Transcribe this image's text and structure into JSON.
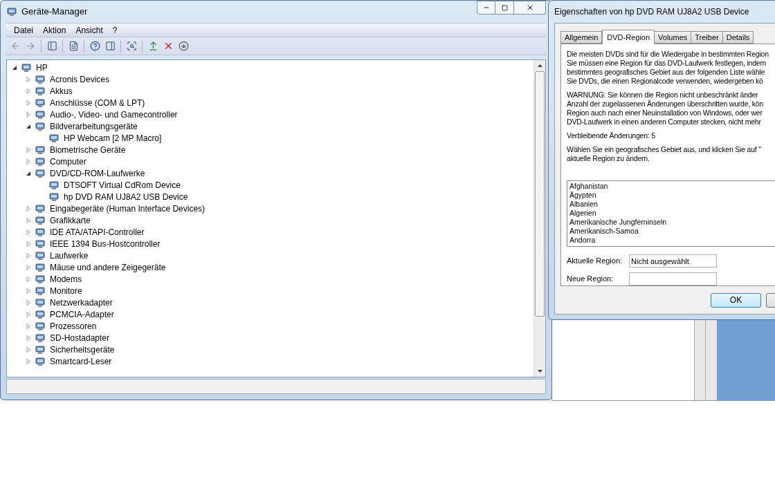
{
  "device_manager": {
    "title": "Geräte-Manager",
    "menu": [
      "Datei",
      "Aktion",
      "Ansicht",
      "?"
    ],
    "tree": [
      {
        "label": "HP",
        "expanded": true,
        "children": [
          {
            "label": "Acronis Devices",
            "expanded": false
          },
          {
            "label": "Akkus",
            "expanded": false
          },
          {
            "label": "Anschlüsse (COM & LPT)",
            "expanded": false
          },
          {
            "label": "Audio-, Video- und Gamecontroller",
            "expanded": false
          },
          {
            "label": "Bildverarbeitungsgeräte",
            "expanded": true,
            "children": [
              {
                "label": "HP Webcam [2 MP Macro]"
              }
            ]
          },
          {
            "label": "Biometrische Geräte",
            "expanded": false
          },
          {
            "label": "Computer",
            "expanded": false
          },
          {
            "label": "DVD/CD-ROM-Laufwerke",
            "expanded": true,
            "children": [
              {
                "label": "DTSOFT Virtual CdRom Device"
              },
              {
                "label": "hp DVD RAM UJ8A2 USB Device"
              }
            ]
          },
          {
            "label": "Eingabegeräte (Human Interface Devices)",
            "expanded": false
          },
          {
            "label": "Grafikkarte",
            "expanded": false
          },
          {
            "label": "IDE ATA/ATAPI-Controller",
            "expanded": false
          },
          {
            "label": "IEEE 1394 Bus-Hostcontroller",
            "expanded": false
          },
          {
            "label": "Laufwerke",
            "expanded": false
          },
          {
            "label": "Mäuse und andere Zeigegeräte",
            "expanded": false
          },
          {
            "label": "Modems",
            "expanded": false
          },
          {
            "label": "Monitore",
            "expanded": false
          },
          {
            "label": "Netzwerkadapter",
            "expanded": false
          },
          {
            "label": "PCMCIA-Adapter",
            "expanded": false
          },
          {
            "label": "Prozessoren",
            "expanded": false
          },
          {
            "label": "SD-Hostadapter",
            "expanded": false
          },
          {
            "label": "Sicherheitsgeräte",
            "expanded": false
          },
          {
            "label": "Smartcard-Leser",
            "expanded": false
          }
        ]
      }
    ]
  },
  "dialog": {
    "title": "Eigenschaften von hp DVD RAM UJ8A2 USB Device",
    "tabs": [
      {
        "label": "Allgemein",
        "selected": false
      },
      {
        "label": "DVD-Region",
        "selected": true
      },
      {
        "label": "Volumes",
        "selected": false
      },
      {
        "label": "Treiber",
        "selected": false
      },
      {
        "label": "Details",
        "selected": false
      }
    ],
    "paragraphs": [
      [
        "Die meisten DVDs sind für die Wiedergabe in bestimmten Region",
        "Sie müssen eine Region für das DVD-Laufwerk festlegen, indem",
        "bestimmtes geografisches Gebiet aus der folgenden Liste wähle",
        "Sie DVDs, die einen Regionalcode verwenden, wiedergeben kö"
      ],
      [
        "WARNUNG: Sie können die Region nicht unbeschränkt änder",
        "Anzahl der zugelassenen Änderungen überschritten wurde, kön",
        "Region auch nach einer Neuinstallation von Windows, oder wer",
        "DVD-Laufwerk in einen anderen Computer stecken, nicht mehr"
      ],
      [
        "Verbleibende Änderungen: 5"
      ],
      [
        "Wählen Sie ein geografisches Gebiet aus, und klicken Sie auf \"",
        "aktuelle Region zu ändern."
      ]
    ],
    "regions": [
      "Afghanistan",
      "Ägypten",
      "Albanien",
      "Algerien",
      "Amerikanische Jungferninseln",
      "Amerikanisch-Samoa",
      "Andorra"
    ],
    "current_region": {
      "label": "Aktuelle Region:",
      "value": "Nicht ausgewählt"
    },
    "new_region": {
      "label": "Neue Region:"
    },
    "ok": "OK"
  }
}
